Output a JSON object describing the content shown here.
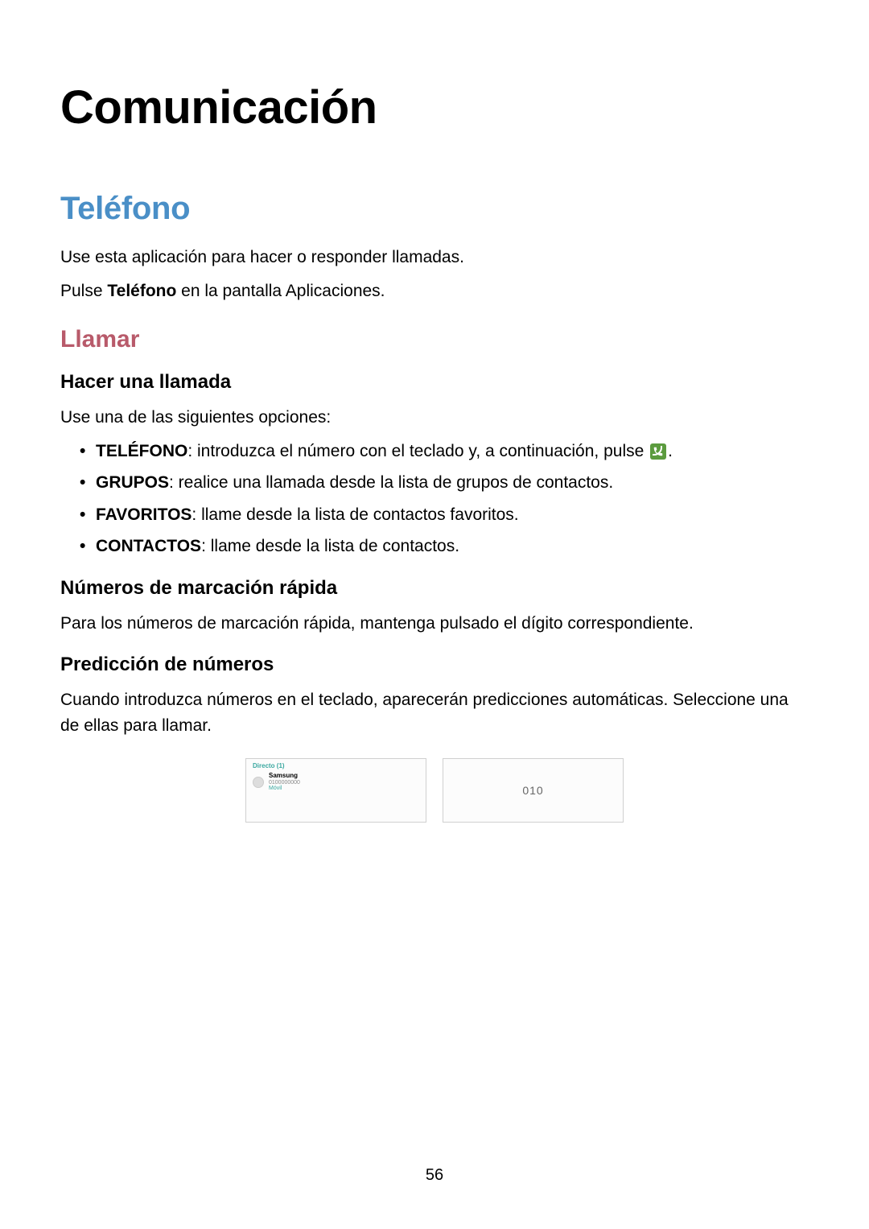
{
  "h1": "Comunicación",
  "h2": "Teléfono",
  "intro1": "Use esta aplicación para hacer o responder llamadas.",
  "intro2_pre": "Pulse ",
  "intro2_bold": "Teléfono",
  "intro2_post": " en la pantalla Aplicaciones.",
  "h3": "Llamar",
  "h4a": "Hacer una llamada",
  "opts_intro": "Use una de las siguientes opciones:",
  "bullets": [
    {
      "bold": "TELÉFONO",
      "rest_pre": ": introduzca el número con el teclado y, a continuación, pulse ",
      "has_icon": true,
      "rest_post": "."
    },
    {
      "bold": "GRUPOS",
      "rest_pre": ": realice una llamada desde la lista de grupos de contactos.",
      "has_icon": false,
      "rest_post": ""
    },
    {
      "bold": "FAVORITOS",
      "rest_pre": ": llame desde la lista de contactos favoritos.",
      "has_icon": false,
      "rest_post": ""
    },
    {
      "bold": "CONTACTOS",
      "rest_pre": ": llame desde la lista de contactos.",
      "has_icon": false,
      "rest_post": ""
    }
  ],
  "h4b": "Números de marcación rápida",
  "speed": "Para los números de marcación rápida, mantenga pulsado el dígito correspondiente.",
  "h4c": "Predicción de números",
  "predict": "Cuando introduzca números en el teclado, aparecerán predicciones automáticas. Seleccione una de ellas para llamar.",
  "ss_left": {
    "header": "Directo (1)",
    "name": "Samsung",
    "sub1": "0100000000",
    "sub2": "Móvil"
  },
  "ss_right_num": "010",
  "page_number": "56"
}
